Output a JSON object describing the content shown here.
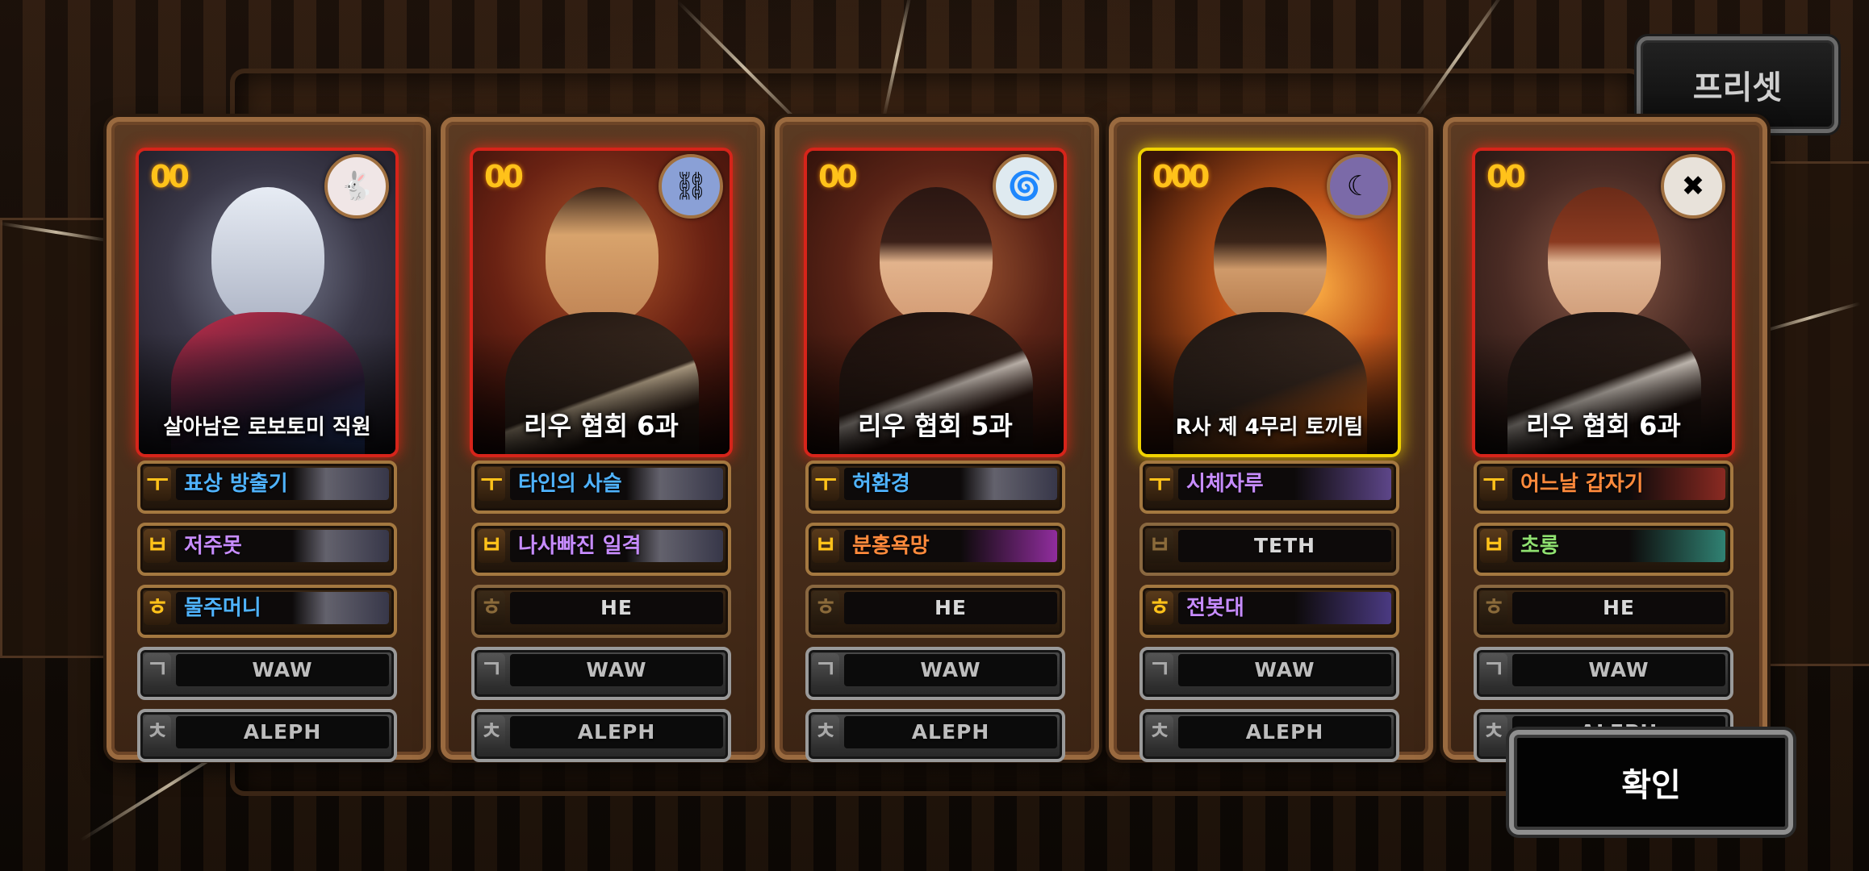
{
  "buttons": {
    "preset": "프리셋",
    "confirm": "확인"
  },
  "colors": {
    "label_blue": "#4fb3ff",
    "label_purple": "#c78cff",
    "label_orange": "#ff8a3c",
    "label_green": "#8fe070",
    "frame_red": "#d6241a",
    "frame_gold": "#f0d300"
  },
  "cards": [
    {
      "rank": "00",
      "emblem_icon": "rabbit-emblem-icon",
      "name": "살아남은 로보토미 직원",
      "slots": [
        {
          "tier": "ㅜ",
          "label": "표상 방출기",
          "color": "#4fb3ff"
        },
        {
          "tier": "ㅂ",
          "label": "저주못",
          "color": "#c78cff"
        },
        {
          "tier": "ㅎ",
          "label": "물주머니",
          "color": "#4fb3ff"
        },
        {
          "tier": "ㄱ",
          "label": "WAW"
        },
        {
          "tier": "ㅊ",
          "label": "ALEPH"
        }
      ]
    },
    {
      "rank": "00",
      "emblem_icon": "chain-emblem-icon",
      "name": "리우 협회 6과",
      "slots": [
        {
          "tier": "ㅜ",
          "label": "타인의 사슬",
          "color": "#4fb3ff"
        },
        {
          "tier": "ㅂ",
          "label": "나사빠진 일격",
          "color": "#c78cff"
        },
        {
          "tier": "ㅎ",
          "label": "HE"
        },
        {
          "tier": "ㄱ",
          "label": "WAW"
        },
        {
          "tier": "ㅊ",
          "label": "ALEPH"
        }
      ]
    },
    {
      "rank": "00",
      "emblem_icon": "swirl-emblem-icon",
      "name": "리우 협회 5과",
      "slots": [
        {
          "tier": "ㅜ",
          "label": "허환경",
          "color": "#4fb3ff"
        },
        {
          "tier": "ㅂ",
          "label": "분홍욕망",
          "color": "#ff8a3c"
        },
        {
          "tier": "ㅎ",
          "label": "HE"
        },
        {
          "tier": "ㄱ",
          "label": "WAW"
        },
        {
          "tier": "ㅊ",
          "label": "ALEPH"
        }
      ]
    },
    {
      "rank": "000",
      "emblem_icon": "moon-emblem-icon",
      "name": "R사 제 4무리 토끼팀",
      "slots": [
        {
          "tier": "ㅜ",
          "label": "시체자루",
          "color": "#c78cff"
        },
        {
          "tier": "ㅂ",
          "label": "TETH"
        },
        {
          "tier": "ㅎ",
          "label": "전봇대",
          "color": "#c78cff"
        },
        {
          "tier": "ㄱ",
          "label": "WAW"
        },
        {
          "tier": "ㅊ",
          "label": "ALEPH"
        }
      ]
    },
    {
      "rank": "00",
      "emblem_icon": "stripe-emblem-icon",
      "name": "리우 협회 6과",
      "slots": [
        {
          "tier": "ㅜ",
          "label": "어느날 갑자기",
          "color": "#ff8a3c"
        },
        {
          "tier": "ㅂ",
          "label": "초롱",
          "color": "#8fe070"
        },
        {
          "tier": "ㅎ",
          "label": "HE"
        },
        {
          "tier": "ㄱ",
          "label": "WAW"
        },
        {
          "tier": "ㅊ",
          "label": "ALEPH"
        }
      ]
    }
  ]
}
